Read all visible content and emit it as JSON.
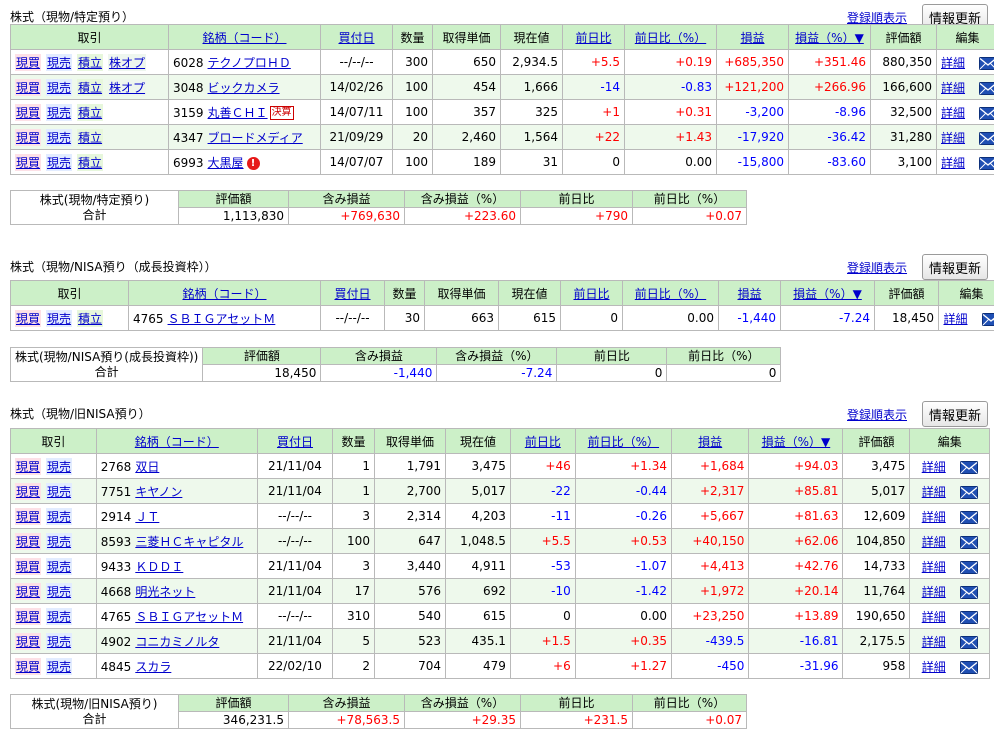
{
  "header_fragment": "",
  "common": {
    "order_link": "登録順表示",
    "refresh_label": "情報更新",
    "detail_label": "詳細",
    "mail_icon": "mail-icon"
  },
  "columns": [
    "取引",
    "銘柄（コード）",
    "買付日",
    "数量",
    "取得単価",
    "現在値",
    "前日比",
    "前日比（%）",
    "損益",
    "損益（%）▼",
    "評価額",
    "編集"
  ],
  "sections": [
    {
      "title": "株式（現物/特定預り）",
      "rows": [
        {
          "links": [
            "現買",
            "現売",
            "積立",
            "株オプ"
          ],
          "code": "6028",
          "name": "テクノプロＨＤ",
          "date": "--/--/--",
          "qty": "300",
          "cost": "650",
          "price": "2,934.5",
          "chg": "+5.5",
          "chgp": "+0.19",
          "pl": "+685,350",
          "plp": "+351.46",
          "val": "880,350"
        },
        {
          "links": [
            "現買",
            "現売",
            "積立",
            "株オプ"
          ],
          "code": "3048",
          "name": "ビックカメラ",
          "date": "14/02/26",
          "qty": "100",
          "cost": "454",
          "price": "1,666",
          "chg": "-14",
          "chgp": "-0.83",
          "pl": "+121,200",
          "plp": "+266.96",
          "val": "166,600"
        },
        {
          "links": [
            "現買",
            "現売",
            "積立"
          ],
          "code": "3159",
          "name": "丸善ＣＨＩ",
          "badge": "決算",
          "date": "14/07/11",
          "qty": "100",
          "cost": "357",
          "price": "325",
          "chg": "+1",
          "chgp": "+0.31",
          "pl": "-3,200",
          "plp": "-8.96",
          "val": "32,500"
        },
        {
          "links": [
            "現買",
            "現売",
            "積立"
          ],
          "code": "4347",
          "name": "ブロードメディア",
          "date": "21/09/29",
          "qty": "20",
          "cost": "2,460",
          "price": "1,564",
          "chg": "+22",
          "chgp": "+1.43",
          "pl": "-17,920",
          "plp": "-36.42",
          "val": "31,280"
        },
        {
          "links": [
            "現買",
            "現売",
            "積立"
          ],
          "code": "6993",
          "name": "大黒屋",
          "alert": "!",
          "date": "14/07/07",
          "qty": "100",
          "cost": "189",
          "price": "31",
          "chg": "0",
          "chgp": "0.00",
          "pl": "-15,800",
          "plp": "-83.60",
          "val": "3,100"
        }
      ],
      "summary": {
        "label1": "株式(現物/特定預り)",
        "label2": "合計",
        "headers": [
          "評価額",
          "含み損益",
          "含み損益（%）",
          "前日比",
          "前日比（%）"
        ],
        "values": [
          "1,113,830",
          "+769,630",
          "+223.60",
          "+790",
          "+0.07"
        ]
      }
    },
    {
      "title": "株式（現物/NISA預り（成長投資枠））",
      "rows": [
        {
          "links": [
            "現買",
            "現売",
            "積立"
          ],
          "code": "4765",
          "name": "ＳＢＩＧアセットＭ",
          "date": "--/--/--",
          "qty": "30",
          "cost": "663",
          "price": "615",
          "chg": "0",
          "chgp": "0.00",
          "pl": "-1,440",
          "plp": "-7.24",
          "val": "18,450"
        }
      ],
      "summary": {
        "label1": "株式(現物/NISA預り(成長投資枠))",
        "label2": "合計",
        "headers": [
          "評価額",
          "含み損益",
          "含み損益（%）",
          "前日比",
          "前日比（%）"
        ],
        "values": [
          "18,450",
          "-1,440",
          "-7.24",
          "0",
          "0"
        ]
      }
    },
    {
      "title": "株式（現物/旧NISA預り）",
      "rows": [
        {
          "links": [
            "現買",
            "現売"
          ],
          "code": "2768",
          "name": "双日",
          "date": "21/11/04",
          "qty": "1",
          "cost": "1,791",
          "price": "3,475",
          "chg": "+46",
          "chgp": "+1.34",
          "pl": "+1,684",
          "plp": "+94.03",
          "val": "3,475"
        },
        {
          "links": [
            "現買",
            "現売"
          ],
          "code": "7751",
          "name": "キヤノン",
          "date": "21/11/04",
          "qty": "1",
          "cost": "2,700",
          "price": "5,017",
          "chg": "-22",
          "chgp": "-0.44",
          "pl": "+2,317",
          "plp": "+85.81",
          "val": "5,017"
        },
        {
          "links": [
            "現買",
            "現売"
          ],
          "code": "2914",
          "name": "ＪＴ",
          "date": "--/--/--",
          "qty": "3",
          "cost": "2,314",
          "price": "4,203",
          "chg": "-11",
          "chgp": "-0.26",
          "pl": "+5,667",
          "plp": "+81.63",
          "val": "12,609"
        },
        {
          "links": [
            "現買",
            "現売"
          ],
          "code": "8593",
          "name": "三菱ＨＣキャピタル",
          "date": "--/--/--",
          "qty": "100",
          "cost": "647",
          "price": "1,048.5",
          "chg": "+5.5",
          "chgp": "+0.53",
          "pl": "+40,150",
          "plp": "+62.06",
          "val": "104,850"
        },
        {
          "links": [
            "現買",
            "現売"
          ],
          "code": "9433",
          "name": "ＫＤＤＩ",
          "date": "21/11/04",
          "qty": "3",
          "cost": "3,440",
          "price": "4,911",
          "chg": "-53",
          "chgp": "-1.07",
          "pl": "+4,413",
          "plp": "+42.76",
          "val": "14,733"
        },
        {
          "links": [
            "現買",
            "現売"
          ],
          "code": "4668",
          "name": "明光ネット",
          "date": "21/11/04",
          "qty": "17",
          "cost": "576",
          "price": "692",
          "chg": "-10",
          "chgp": "-1.42",
          "pl": "+1,972",
          "plp": "+20.14",
          "val": "11,764"
        },
        {
          "links": [
            "現買",
            "現売"
          ],
          "code": "4765",
          "name": "ＳＢＩＧアセットＭ",
          "date": "--/--/--",
          "qty": "310",
          "cost": "540",
          "price": "615",
          "chg": "0",
          "chgp": "0.00",
          "pl": "+23,250",
          "plp": "+13.89",
          "val": "190,650"
        },
        {
          "links": [
            "現買",
            "現売"
          ],
          "code": "4902",
          "name": "コニカミノルタ",
          "date": "21/11/04",
          "qty": "5",
          "cost": "523",
          "price": "435.1",
          "chg": "+1.5",
          "chgp": "+0.35",
          "pl": "-439.5",
          "plp": "-16.81",
          "val": "2,175.5"
        },
        {
          "links": [
            "現買",
            "現売"
          ],
          "code": "4845",
          "name": "スカラ",
          "date": "22/02/10",
          "qty": "2",
          "cost": "704",
          "price": "479",
          "chg": "+6",
          "chgp": "+1.27",
          "pl": "-450",
          "plp": "-31.96",
          "val": "958"
        }
      ],
      "summary": {
        "label1": "株式(現物/旧NISA預り)",
        "label2": "合計",
        "headers": [
          "評価額",
          "含み損益",
          "含み損益（%）",
          "前日比",
          "前日比（%）"
        ],
        "values": [
          "346,231.5",
          "+78,563.5",
          "+29.35",
          "+231.5",
          "+0.07"
        ]
      }
    }
  ]
}
